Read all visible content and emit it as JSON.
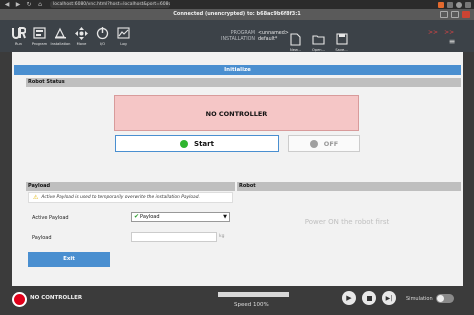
{
  "browser": {
    "url": "localhost:6080/vnc.html?host=localhost&port=6080"
  },
  "window": {
    "title": "Connected (unencrypted) to: b68ac9b6f8f3:1"
  },
  "toolbar": {
    "items": [
      {
        "label": "Run",
        "icon": "ur-logo-icon"
      },
      {
        "label": "Program",
        "icon": "program-icon"
      },
      {
        "label": "Installation",
        "icon": "installation-icon"
      },
      {
        "label": "Move",
        "icon": "move-icon"
      },
      {
        "label": "I/O",
        "icon": "io-icon"
      },
      {
        "label": "Log",
        "icon": "log-icon"
      }
    ],
    "program_key": "PROGRAM",
    "program_value": "<unnamed>",
    "installation_key": "INSTALLATION",
    "installation_value": "default*",
    "file_buttons": [
      {
        "label": "New..."
      },
      {
        "label": "Open..."
      },
      {
        "label": "Save..."
      }
    ]
  },
  "initialize": {
    "header": "Initialize",
    "robot_status_header": "Robot Status",
    "controller_status": "NO CONTROLLER",
    "start_label": "Start",
    "off_label": "OFF",
    "payload_header": "Payload",
    "robot_header": "Robot",
    "info_text": "Active Payload is used to temporarily overwrite the installation Payload.",
    "active_payload_label": "Active Payload",
    "active_payload_value": "Payload",
    "payload_label": "Payload",
    "payload_unit": "kg",
    "power_message": "Power ON the robot first",
    "exit_label": "Exit"
  },
  "footer": {
    "status": "NO CONTROLLER",
    "speed_label": "Speed 100%",
    "speed_fraction": 1.0,
    "simulation_label": "Simulation"
  },
  "colors": {
    "accent": "#4a8fd0",
    "error_bg": "#f5c6c6",
    "estop": "#e0001a",
    "start_dot": "#2fb52f",
    "off_dot": "#a0a0a0"
  }
}
